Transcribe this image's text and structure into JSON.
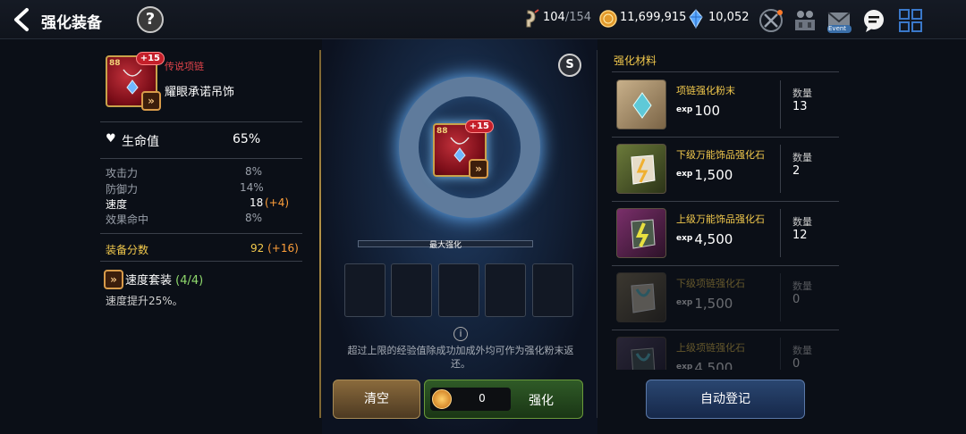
{
  "header": {
    "title": "强化装备",
    "help_label": "?",
    "stamina": {
      "current": "104",
      "max": "/154"
    },
    "gold": "11,699,915",
    "crystal": "10,052",
    "event_label": "Event"
  },
  "equipment": {
    "level": "88",
    "plus": "+15",
    "grade": "传说项链",
    "name": "耀眼承诺吊饰",
    "main_stat": {
      "label": "生命值",
      "value": "65%"
    },
    "sub_stats": [
      {
        "label": "攻击力",
        "value": "8%",
        "bonus": ""
      },
      {
        "label": "防御力",
        "value": "14%",
        "bonus": ""
      },
      {
        "label": "速度",
        "value": "18",
        "bonus": "(+4)"
      },
      {
        "label": "效果命中",
        "value": "8%",
        "bonus": ""
      }
    ],
    "score": {
      "label": "装备分数",
      "value": "92",
      "bonus": "(+16)"
    },
    "set": {
      "name": "速度套装",
      "count": "(4/4)",
      "desc": "速度提升25%。"
    }
  },
  "enhance": {
    "s_label": "S",
    "bar_label": "最大强化",
    "note": "超过上限的经验值除成功加成外均可作为强化粉末返还。",
    "clear_label": "清空",
    "cost": "0",
    "enhance_label": "强化"
  },
  "materials": {
    "title": "强化材料",
    "qty_label": "数量",
    "exp_tag": "exp",
    "items": [
      {
        "name": "项链强化粉末",
        "exp": "100",
        "qty": "13",
        "color": "#f2c94c"
      },
      {
        "name": "下级万能饰品强化石",
        "exp": "1,500",
        "qty": "2",
        "color": "#f2c94c"
      },
      {
        "name": "上级万能饰品强化石",
        "exp": "4,500",
        "qty": "12",
        "color": "#f2c94c"
      },
      {
        "name": "下级项链强化石",
        "exp": "1,500",
        "qty": "0",
        "color": "#f2c94c"
      },
      {
        "name": "上级项链强化石",
        "exp": "4,500",
        "qty": "0",
        "color": "#f2c94c"
      }
    ],
    "auto_label": "自动登记"
  }
}
